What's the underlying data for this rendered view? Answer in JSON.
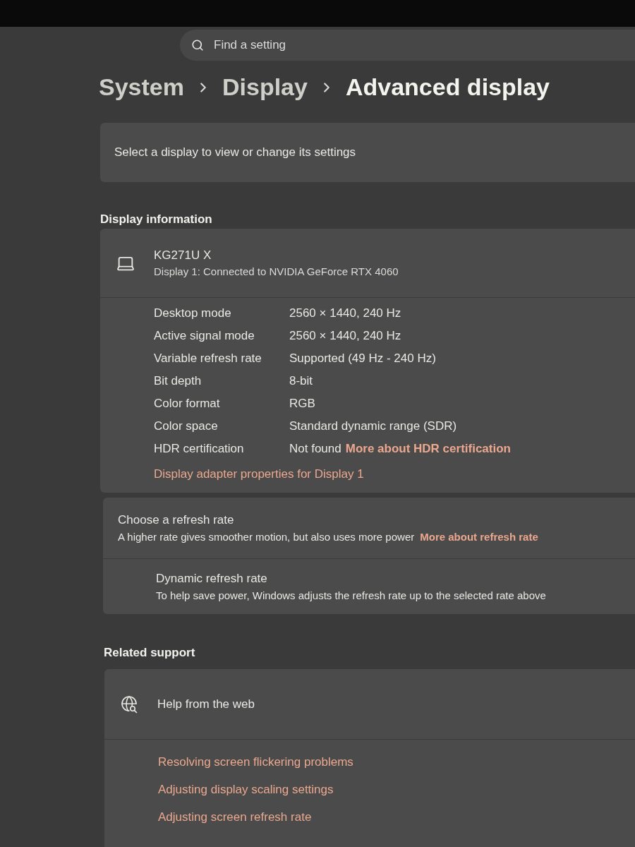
{
  "search": {
    "placeholder": "Find a setting"
  },
  "breadcrumb": [
    {
      "label": "System",
      "selected": false
    },
    {
      "label": "Display",
      "selected": false
    },
    {
      "label": "Advanced display",
      "selected": true
    }
  ],
  "display_select": {
    "label": "Select a display to view or change its settings"
  },
  "display_information": {
    "heading": "Display information",
    "monitor": {
      "name": "KG271U X",
      "subtitle": "Display 1: Connected to NVIDIA GeForce RTX 4060"
    },
    "properties": [
      {
        "label": "Desktop mode",
        "value": "2560 × 1440, 240 Hz"
      },
      {
        "label": "Active signal mode",
        "value": "2560 × 1440, 240 Hz"
      },
      {
        "label": "Variable refresh rate",
        "value": "Supported (49 Hz - 240 Hz)"
      },
      {
        "label": "Bit depth",
        "value": "8-bit"
      },
      {
        "label": "Color format",
        "value": "RGB"
      },
      {
        "label": "Color space",
        "value": "Standard dynamic range (SDR)"
      },
      {
        "label": "HDR certification",
        "value": "Not found",
        "link": "More about HDR certification"
      }
    ],
    "adapter_link": "Display adapter properties for Display 1"
  },
  "refresh_rate": {
    "title": "Choose a refresh rate",
    "description": "A higher rate gives smoother motion, but also uses more power",
    "link": "More about refresh rate",
    "dynamic": {
      "title": "Dynamic refresh rate",
      "description": "To help save power, Windows adjusts the refresh rate up to the selected rate above"
    }
  },
  "related_support": {
    "heading": "Related support",
    "help": {
      "title": "Help from the web"
    },
    "links": [
      "Resolving screen flickering problems",
      "Adjusting display scaling settings",
      "Adjusting screen refresh rate"
    ]
  }
}
